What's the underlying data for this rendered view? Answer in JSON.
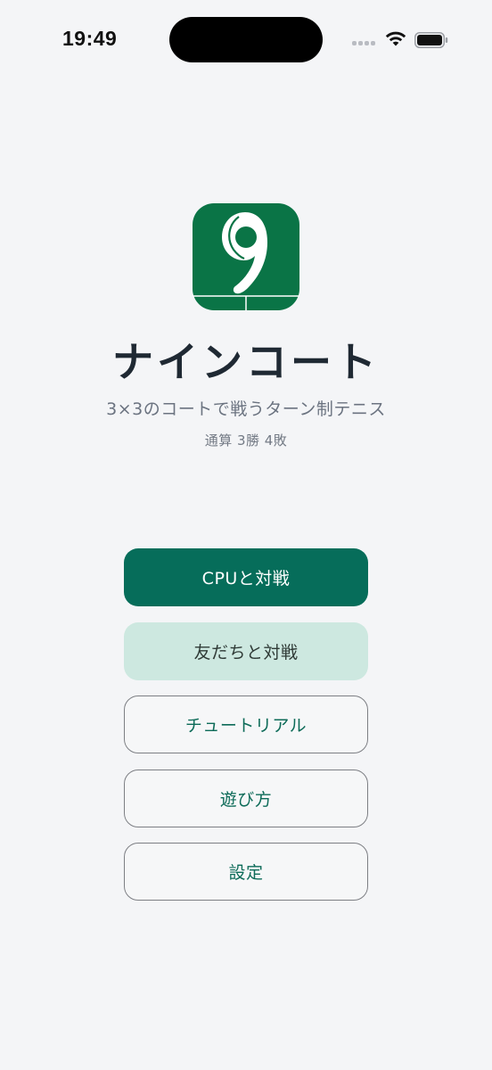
{
  "status_bar": {
    "time": "19:49"
  },
  "app": {
    "title": "ナインコート",
    "subtitle": "3×3のコートで戦うターン制テニス",
    "record": "通算 3勝 4敗",
    "icon_name": "nine-court-logo-icon",
    "icon_digit": "9"
  },
  "menu": {
    "cpu_match": "CPUと対戦",
    "friend_match": "友だちと対戦",
    "tutorial": "チュートリアル",
    "how_to_play": "遊び方",
    "settings": "設定"
  },
  "colors": {
    "background": "#f4f5f7",
    "brand_green": "#0a7446",
    "primary_button": "#066d5a",
    "secondary_button": "#cde8e0",
    "outline_text": "#0d6b58"
  }
}
